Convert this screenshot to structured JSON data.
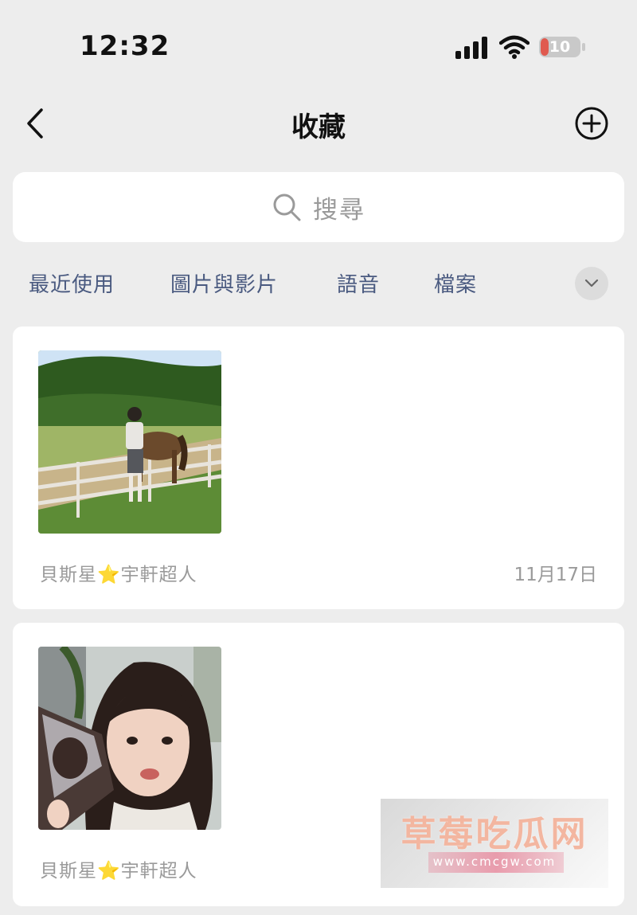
{
  "status_bar": {
    "time": "12:32",
    "battery_level": "10",
    "icons": [
      "signal-icon",
      "wifi-icon",
      "battery-icon"
    ]
  },
  "nav": {
    "title": "收藏",
    "icons": [
      "back-icon",
      "add-icon"
    ]
  },
  "search": {
    "placeholder": "搜尋",
    "icon": "search-icon"
  },
  "filters": {
    "tabs": [
      {
        "label": "最近使用"
      },
      {
        "label": "圖片與影片"
      },
      {
        "label": "語音"
      },
      {
        "label": "檔案"
      }
    ],
    "expand_icon": "chevron-down-icon"
  },
  "favorites": [
    {
      "type": "photo",
      "image_desc_icon": "photo-thumbnail",
      "source": "貝斯星⭐宇軒超人",
      "date": "11月17日"
    },
    {
      "type": "photo",
      "image_desc_icon": "photo-thumbnail",
      "source": "貝斯星⭐宇軒超人",
      "date": ""
    }
  ],
  "watermark": {
    "title": "草莓吃瓜网",
    "url": "www.cmcgw.com"
  },
  "colors": {
    "background": "#ededed",
    "card": "#ffffff",
    "tab_text": "#4a5a80",
    "meta_text": "#9a9a9a",
    "battery_fill": "#e05a4f"
  }
}
